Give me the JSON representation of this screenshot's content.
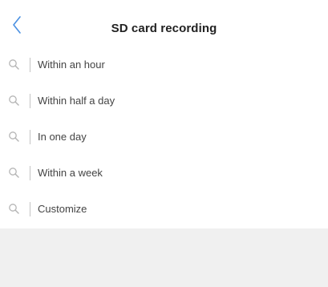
{
  "header": {
    "title": "SD card recording",
    "back_icon": "chevron-left-icon",
    "accent_color": "#4a90e2"
  },
  "options": [
    {
      "label": "Within an hour",
      "icon": "search-icon"
    },
    {
      "label": "Within half a day",
      "icon": "search-icon"
    },
    {
      "label": "In one day",
      "icon": "search-icon"
    },
    {
      "label": "Within a week",
      "icon": "search-icon"
    },
    {
      "label": "Customize",
      "icon": "search-icon"
    }
  ]
}
